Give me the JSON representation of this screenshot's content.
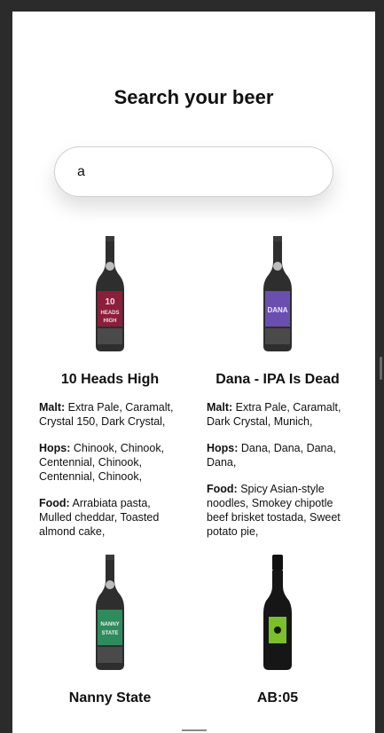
{
  "page": {
    "title": "Search your beer"
  },
  "search": {
    "value": "a"
  },
  "labels": {
    "malt": "Malt:",
    "hops": "Hops:",
    "food": "Food:"
  },
  "beers": [
    {
      "name": "10 Heads High",
      "malt": "Extra Pale, Caramalt, Crystal 150, Dark Crystal,",
      "hops": "Chinook, Chinook, Centennial, Chinook, Centennial, Chinook,",
      "food": "Arrabiata pasta, Mulled cheddar, Toasted almond cake,",
      "label_color": "#8a1f3b",
      "label_text": [
        "10",
        "HEADS",
        "HIGH"
      ]
    },
    {
      "name": "Dana - IPA Is Dead",
      "malt": "Extra Pale, Caramalt, Dark Crystal, Munich,",
      "hops": "Dana, Dana, Dana, Dana,",
      "food": "Spicy Asian-style noodles, Smokey chipotle beef brisket tostada, Sweet potato pie,",
      "label_color": "#6a4fb0",
      "label_text": [
        "DANA"
      ]
    },
    {
      "name": "Nanny State",
      "label_color": "#2f8a5c",
      "label_text": [
        "NANNY",
        "STATE"
      ]
    },
    {
      "name": "AB:05",
      "label_color": "#7bbf2a",
      "label_text": []
    }
  ],
  "colors": {
    "background": "#ffffff",
    "frame": "#2b2b2b",
    "text": "#111111"
  }
}
